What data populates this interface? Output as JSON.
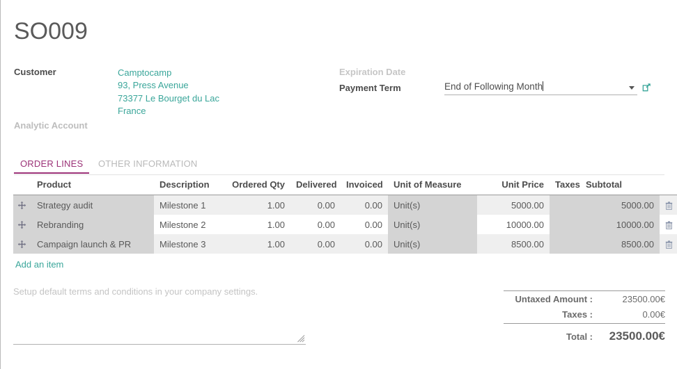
{
  "record": {
    "title": "SO009"
  },
  "header": {
    "customer_label": "Customer",
    "customer_lines": [
      "Camptocamp",
      "93, Press Avenue",
      "73377 Le Bourget du Lac",
      "France"
    ],
    "analytic_account_label": "Analytic Account",
    "analytic_account_value": "",
    "expiration_date_label": "Expiration Date",
    "expiration_date_value": "",
    "payment_term_label": "Payment Term",
    "payment_term_value": "End of Following Month"
  },
  "tabs": [
    {
      "label": "ORDER LINES",
      "active": true
    },
    {
      "label": "OTHER INFORMATION",
      "active": false
    }
  ],
  "order_lines": {
    "columns": [
      "Product",
      "Description",
      "Ordered Qty",
      "Delivered",
      "Invoiced",
      "Unit of Measure",
      "Unit Price",
      "Taxes",
      "Subtotal"
    ],
    "rows": [
      {
        "product": "Strategy audit",
        "description": "Milestone 1",
        "ordered_qty": "1.00",
        "delivered": "0.00",
        "invoiced": "0.00",
        "uom": "Unit(s)",
        "unit_price": "5000.00",
        "taxes": "",
        "subtotal": "5000.00"
      },
      {
        "product": "Rebranding",
        "description": "Milestone 2",
        "ordered_qty": "1.00",
        "delivered": "0.00",
        "invoiced": "0.00",
        "uom": "Unit(s)",
        "unit_price": "10000.00",
        "taxes": "",
        "subtotal": "10000.00"
      },
      {
        "product": "Campaign launch & PR",
        "description": "Milestone 3",
        "ordered_qty": "1.00",
        "delivered": "0.00",
        "invoiced": "0.00",
        "uom": "Unit(s)",
        "unit_price": "8500.00",
        "taxes": "",
        "subtotal": "8500.00"
      }
    ],
    "add_item_label": "Add an item"
  },
  "terms": {
    "placeholder": "Setup default terms and conditions in your company settings.",
    "value": ""
  },
  "totals": {
    "untaxed_label": "Untaxed Amount :",
    "untaxed_value": "23500.00€",
    "taxes_label": "Taxes :",
    "taxes_value": "0.00€",
    "total_label": "Total :",
    "total_value": "23500.00€"
  },
  "colors": {
    "accent_teal": "#3aa69a",
    "tab_active": "#9b3277",
    "text": "#4c4c4c",
    "muted": "#bdbdbd",
    "col_dark": "#d4d4d4",
    "col_stripe": "#efefef"
  }
}
